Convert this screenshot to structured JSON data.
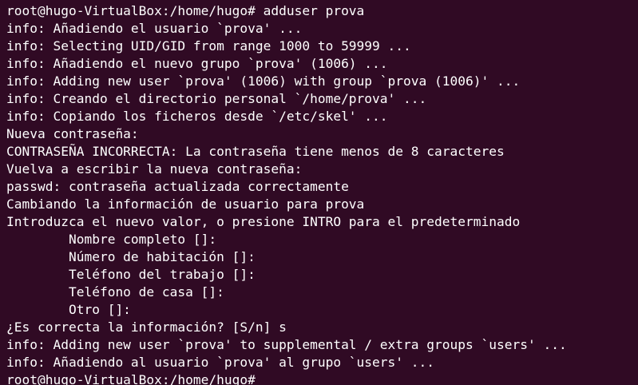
{
  "terminal": {
    "colors": {
      "background": "#300a24",
      "foreground": "#ffffff"
    },
    "lines": [
      "root@hugo-VirtualBox:/home/hugo# adduser prova",
      "info: Añadiendo el usuario `prova' ...",
      "info: Selecting UID/GID from range 1000 to 59999 ...",
      "info: Añadiendo el nuevo grupo `prova' (1006) ...",
      "info: Adding new user `prova' (1006) with group `prova (1006)' ...",
      "info: Creando el directorio personal `/home/prova' ...",
      "info: Copiando los ficheros desde `/etc/skel' ...",
      "Nueva contraseña:",
      "CONTRASEÑA INCORRECTA: La contraseña tiene menos de 8 caracteres",
      "Vuelva a escribir la nueva contraseña:",
      "passwd: contraseña actualizada correctamente",
      "Cambiando la información de usuario para prova",
      "Introduzca el nuevo valor, o presione INTRO para el predeterminado",
      "        Nombre completo []:",
      "        Número de habitación []:",
      "        Teléfono del trabajo []:",
      "        Teléfono de casa []:",
      "        Otro []:",
      "¿Es correcta la información? [S/n] s",
      "info: Adding new user `prova' to supplemental / extra groups `users' ...",
      "info: Añadiendo al usuario `prova' al grupo `users' ...",
      "root@hugo-VirtualBox:/home/hugo# "
    ]
  }
}
